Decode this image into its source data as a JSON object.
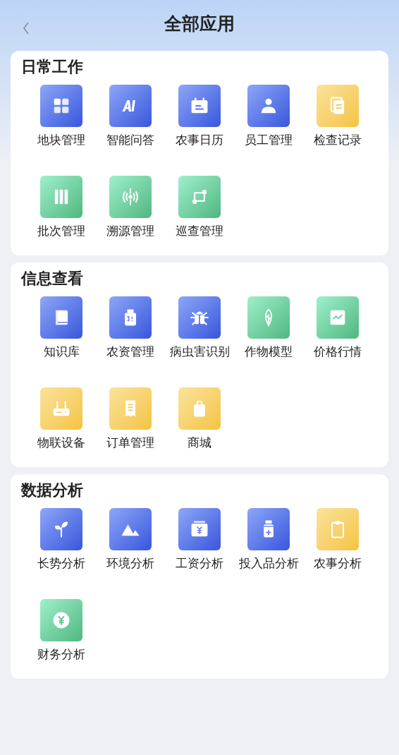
{
  "header": {
    "title": "全部应用"
  },
  "sections": [
    {
      "title": "日常工作",
      "apps": [
        {
          "label": "地块管理",
          "kind": "blue"
        },
        {
          "label": "智能问答",
          "kind": "blue"
        },
        {
          "label": "农事日历",
          "kind": "blue"
        },
        {
          "label": "员工管理",
          "kind": "blue"
        },
        {
          "label": "检查记录",
          "kind": "yellow"
        },
        {
          "label": "批次管理",
          "kind": "green"
        },
        {
          "label": "溯源管理",
          "kind": "green"
        },
        {
          "label": "巡查管理",
          "kind": "green"
        }
      ]
    },
    {
      "title": "信息查看",
      "apps": [
        {
          "label": "知识库",
          "kind": "blue"
        },
        {
          "label": "农资管理",
          "kind": "blue"
        },
        {
          "label": "病虫害识别",
          "kind": "blue"
        },
        {
          "label": "作物模型",
          "kind": "green"
        },
        {
          "label": "价格行情",
          "kind": "green"
        },
        {
          "label": "物联设备",
          "kind": "yellow"
        },
        {
          "label": "订单管理",
          "kind": "yellow"
        },
        {
          "label": "商城",
          "kind": "yellow"
        }
      ]
    },
    {
      "title": "数据分析",
      "apps": [
        {
          "label": "长势分析",
          "kind": "blue"
        },
        {
          "label": "环境分析",
          "kind": "blue"
        },
        {
          "label": "工资分析",
          "kind": "blue"
        },
        {
          "label": "投入品分析",
          "kind": "blue"
        },
        {
          "label": "农事分析",
          "kind": "yellow"
        },
        {
          "label": "财务分析",
          "kind": "green"
        }
      ]
    }
  ]
}
